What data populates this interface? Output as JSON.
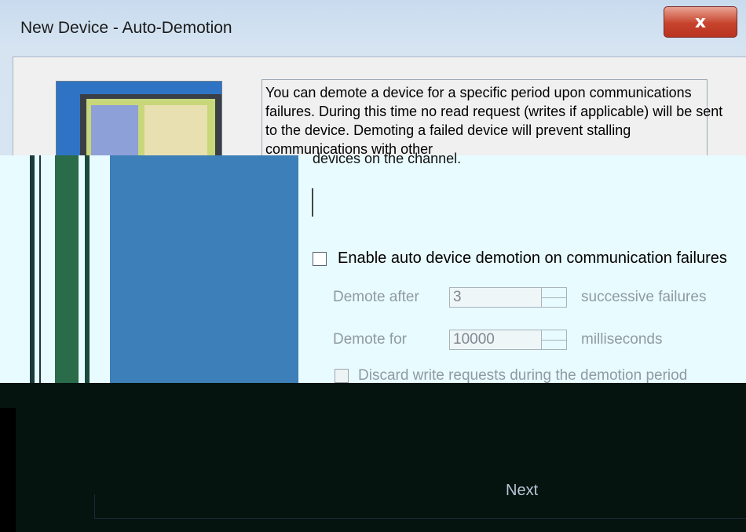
{
  "window": {
    "title": "New Device - Auto-Demotion",
    "close_label": "x"
  },
  "description": {
    "upper": "You can demote a device for a specific period upon communications failures. During this time no read request (writes if applicable) will be sent to the device. Demoting a failed device will prevent stalling communications with other",
    "lower": "devices on the channel."
  },
  "enable": {
    "label": "Enable auto device demotion on communication failures",
    "checked": false
  },
  "demote_after": {
    "label": "Demote after",
    "value": "3",
    "suffix": "successive failures"
  },
  "demote_for": {
    "label": "Demote for",
    "value": "10000",
    "suffix": "milliseconds"
  },
  "discard": {
    "label": "Discard write requests during the demotion period",
    "checked": false
  },
  "footer": {
    "next_label": "Next"
  },
  "colors": {
    "title_close": "#c7432c",
    "graphic_bg": "#2f74c4",
    "glitch_band": "#e8fbff",
    "glitch_dark": "#05140f"
  }
}
